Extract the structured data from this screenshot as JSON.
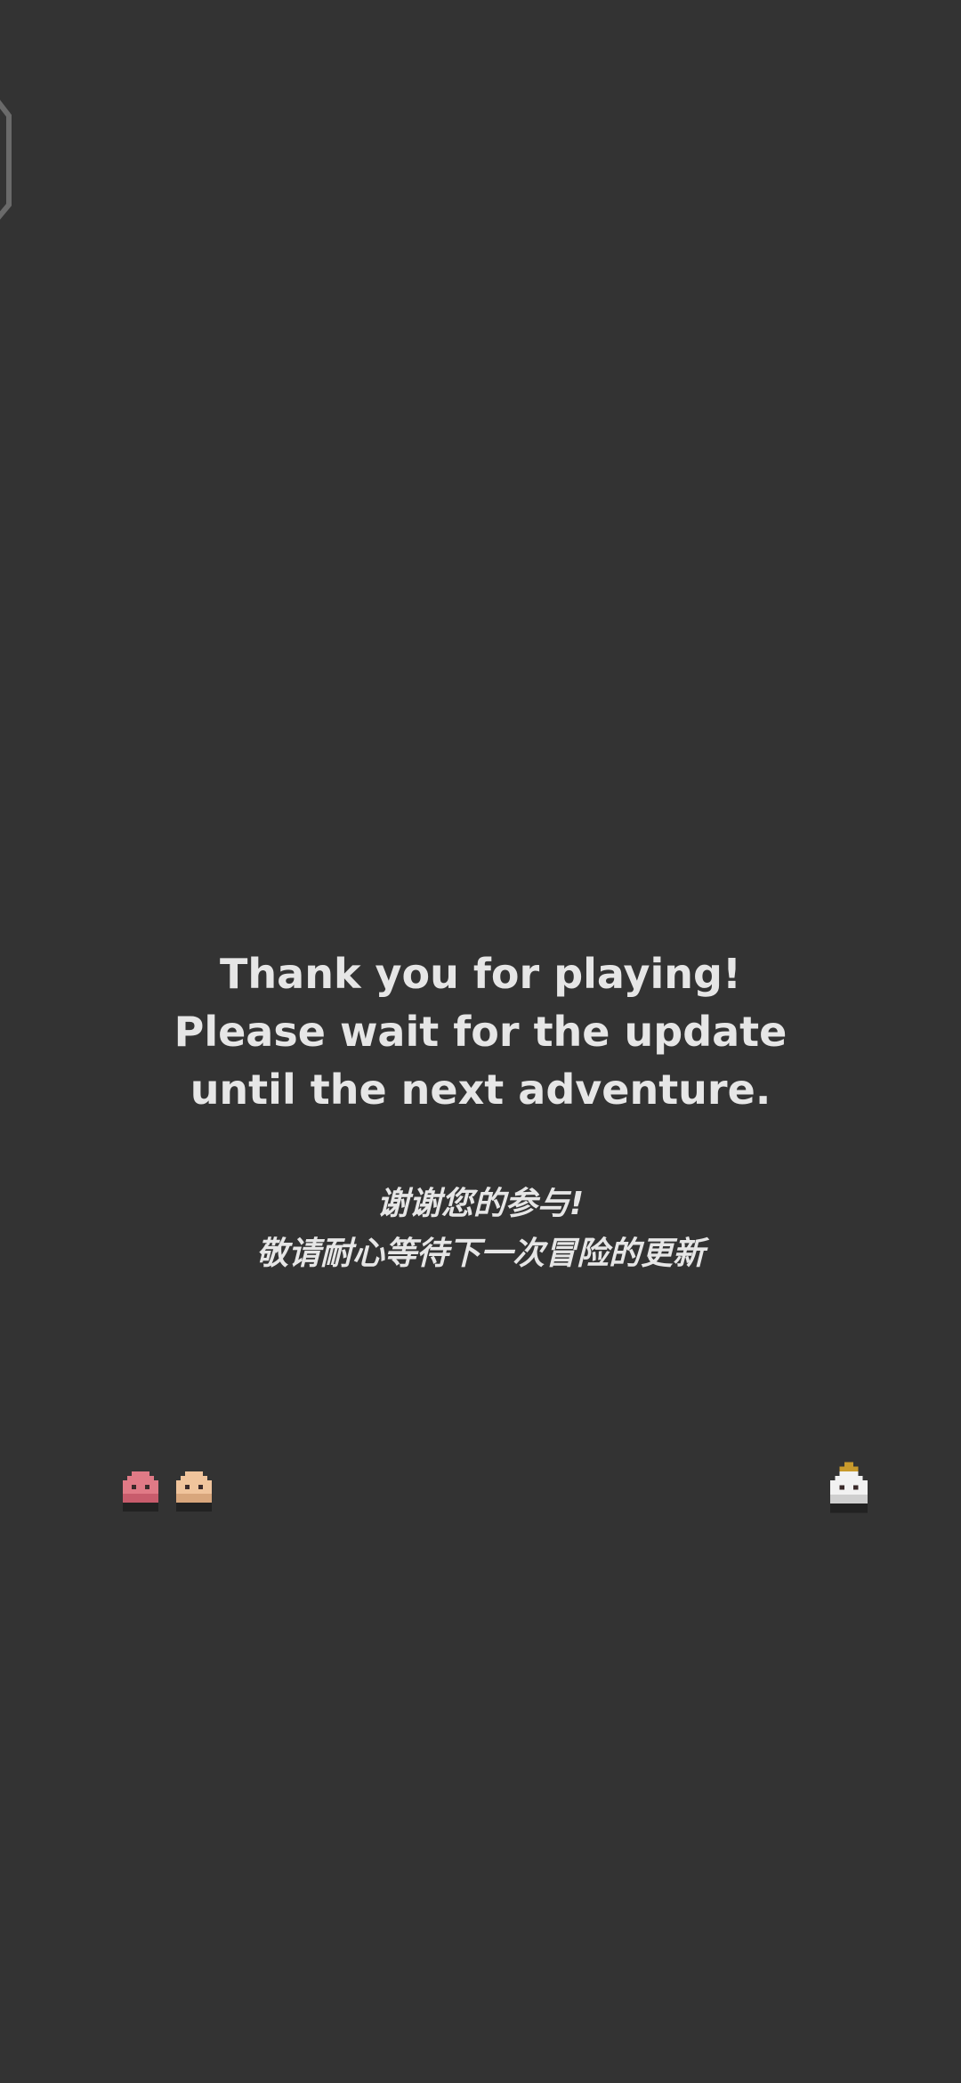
{
  "ending": {
    "message_en": [
      "Thank you for playing!",
      "Please wait for the update",
      "until the next adventure."
    ],
    "message_zh": [
      "谢谢您的参与!",
      "敬请耐心等待下一次冒险的更新"
    ]
  },
  "sprites": [
    {
      "name": "pink-blob-character",
      "color": "#e07a86"
    },
    {
      "name": "peach-blob-character",
      "color": "#f0c49c"
    },
    {
      "name": "white-crowned-character",
      "color": "#f2f2f2",
      "crown_color": "#c89a2c"
    }
  ],
  "colors": {
    "background": "#333333",
    "text": "#e6e6e6",
    "frame_outline": "#6a6a6a"
  }
}
